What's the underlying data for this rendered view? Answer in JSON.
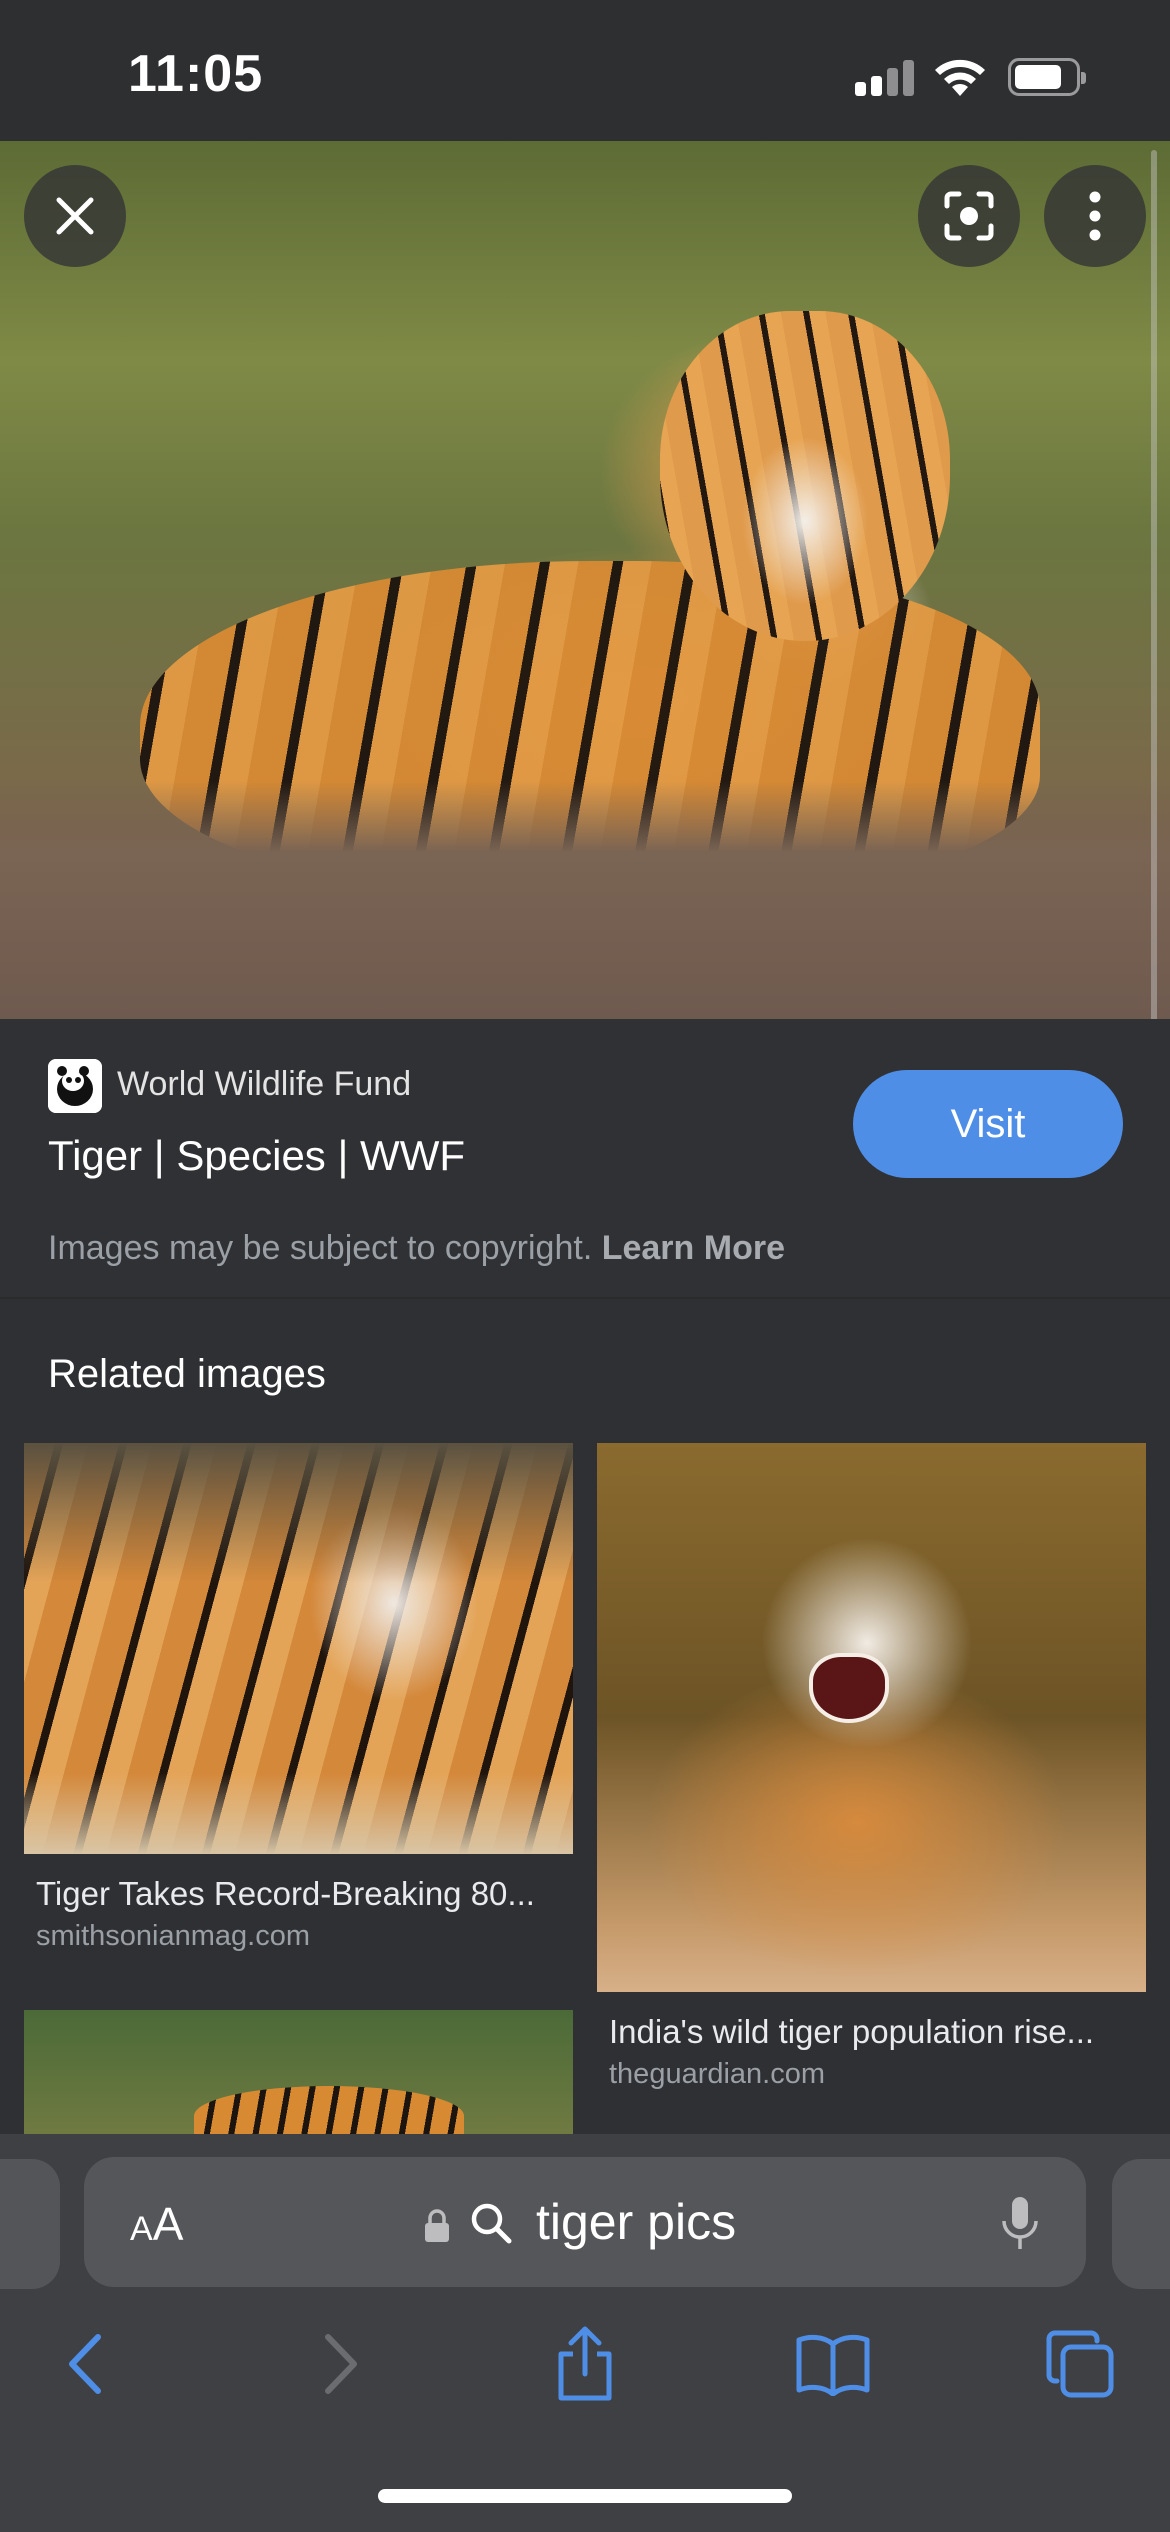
{
  "status_bar": {
    "time": "11:05"
  },
  "source": {
    "site_name": "World Wildlife Fund",
    "page_title": "Tiger | Species | WWF",
    "visit_label": "Visit",
    "copyright_text": "Images may be subject to copyright.",
    "learn_more_label": "Learn More"
  },
  "related": {
    "heading": "Related images",
    "items": [
      {
        "caption": "Tiger Takes Record-Breaking 80...",
        "domain": "smithsonianmag.com"
      },
      {
        "caption": "India's wild tiger population rise...",
        "domain": "theguardian.com"
      }
    ]
  },
  "browser": {
    "text_size_label_small": "A",
    "text_size_label_large": "A",
    "query": "tiger pics"
  },
  "colors": {
    "accent": "#4f8ee6",
    "background": "#303134"
  }
}
